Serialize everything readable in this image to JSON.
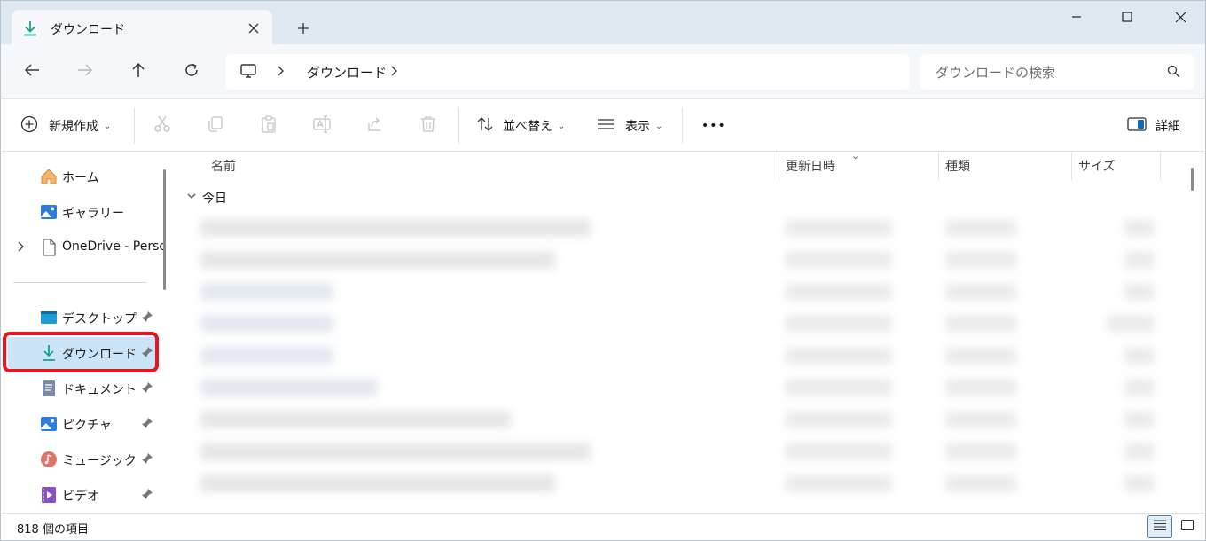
{
  "tab": {
    "title": "ダウンロード",
    "close_icon": "close-icon",
    "new_tab_icon": "plus-icon"
  },
  "window": {
    "minimize_icon": "minimize-icon",
    "maximize_icon": "maximize-icon",
    "close_icon": "close-icon"
  },
  "address": {
    "breadcrumb": "ダウンロード",
    "search_placeholder": "ダウンロードの検索"
  },
  "toolbar": {
    "new_label": "新規作成",
    "sort_label": "並べ替え",
    "view_label": "表示",
    "more_label": "•••",
    "details_label": "詳細"
  },
  "sidebar": {
    "items": [
      {
        "label": "ホーム",
        "icon": "home-icon"
      },
      {
        "label": "ギャラリー",
        "icon": "gallery-icon"
      },
      {
        "label": "OneDrive - Perso",
        "icon": "onedrive-icon"
      },
      {
        "label": "デスクトップ",
        "icon": "desktop-icon"
      },
      {
        "label": "ダウンロード",
        "icon": "download-icon"
      },
      {
        "label": "ドキュメント",
        "icon": "document-icon"
      },
      {
        "label": "ピクチャ",
        "icon": "picture-icon"
      },
      {
        "label": "ミュージック",
        "icon": "music-icon"
      },
      {
        "label": "ビデオ",
        "icon": "video-icon"
      }
    ]
  },
  "columns": {
    "name": "名前",
    "modified": "更新日時",
    "type": "種類",
    "size": "サイズ"
  },
  "group": {
    "label": "今日"
  },
  "status": {
    "count": "818 個の項目"
  },
  "colors": {
    "accent": "#0f6cbd",
    "selected_bg": "#cce4f7",
    "highlight": "#e8141e",
    "download_green": "#1aa38a"
  }
}
